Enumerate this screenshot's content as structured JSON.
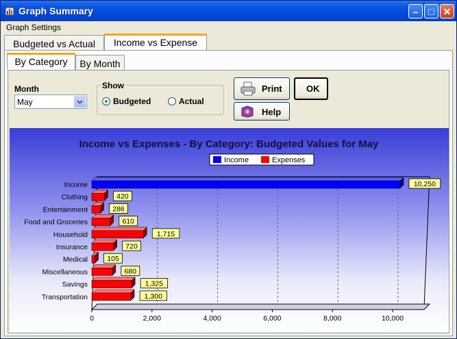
{
  "window": {
    "title": "Graph Summary"
  },
  "menu": {
    "graph_settings": "Graph Settings"
  },
  "tabs": {
    "budgeted_vs_actual": "Budgeted vs Actual",
    "income_vs_expense": "Income vs Expense"
  },
  "subtabs": {
    "by_category": "By Category",
    "by_month": "By Month"
  },
  "controls": {
    "month_label": "Month",
    "month_value": "May",
    "show_label": "Show",
    "budgeted": "Budgeted",
    "actual": "Actual",
    "print": "Print",
    "ok": "OK",
    "help": "Help"
  },
  "colors": {
    "income": "#0000ff",
    "expense": "#ff0000",
    "label_bg": "#ffff99"
  },
  "chart_data": {
    "type": "bar",
    "orientation": "horizontal",
    "title": "Income vs Expenses - By Category: Budgeted Values  for May",
    "legend": [
      "Income",
      "Expenses"
    ],
    "legend_placement": "top-center",
    "categories": [
      "Income",
      "Clothing",
      "Entertainment",
      "Food and Groceries",
      "Household",
      "Insurance",
      "Medical",
      "Miscellaneous",
      "Savings",
      "Transportation"
    ],
    "values": [
      10250,
      420,
      286,
      610,
      1715,
      720,
      105,
      680,
      1325,
      1300
    ],
    "value_labels": [
      "10,250",
      "420",
      "286",
      "610",
      "1,715",
      "720",
      "105",
      "680",
      "1,325",
      "1,300"
    ],
    "series_index": [
      0,
      1,
      1,
      1,
      1,
      1,
      1,
      1,
      1,
      1
    ],
    "xlim": [
      0,
      11000
    ],
    "xticks": [
      "0",
      "2,000",
      "4,000",
      "6,000",
      "8,000",
      "10,000"
    ],
    "grid": true
  }
}
